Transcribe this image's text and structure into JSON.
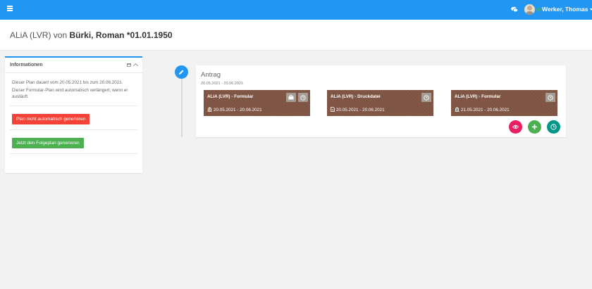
{
  "topbar": {
    "menu_icon": "hamburger-icon",
    "chat_icon": "comments-icon",
    "user_name": "Werker, Thomas",
    "accent": "#2196f3"
  },
  "header": {
    "title_prefix": "ALiA (LVR) von",
    "title_name": "Bürki, Roman *01.01.1950"
  },
  "info": {
    "title": "Informationen",
    "text1": "Dieser Plan dauert vom 20.05.2021 bis zum 20.06.2021.",
    "text2": "Dieser Formular-Plan wird automatisch verlängert, wenn er ausläuft.",
    "button_stop": "Plan nicht automatisch generieren",
    "button_generate": "Jetzt den Folgeplan generieren"
  },
  "antrag": {
    "title": "Antrag",
    "range": "20.05.2021 - 20.06.2021",
    "cards": [
      {
        "name": "ALiA (LVR) - Formular",
        "date": "20.05.2021 - 20.06.2021",
        "date_icon": "bank-icon",
        "has_briefcase": true
      },
      {
        "name": "ALiA (LVR) - Druckdatei",
        "date": "20.05.2021 - 20.06.2021",
        "date_icon": "file-icon",
        "has_briefcase": false
      },
      {
        "name": "ALiA (LVR) - Formular",
        "date": "21.05.2021 - 20.06.2021",
        "date_icon": "bank-icon",
        "has_briefcase": false
      }
    ],
    "card_color": "#7d5241",
    "actions": [
      {
        "icon": "eye-icon",
        "color": "#e91e63"
      },
      {
        "icon": "plus-icon",
        "color": "#4caf50"
      },
      {
        "icon": "clock-icon",
        "color": "#009688"
      }
    ]
  }
}
